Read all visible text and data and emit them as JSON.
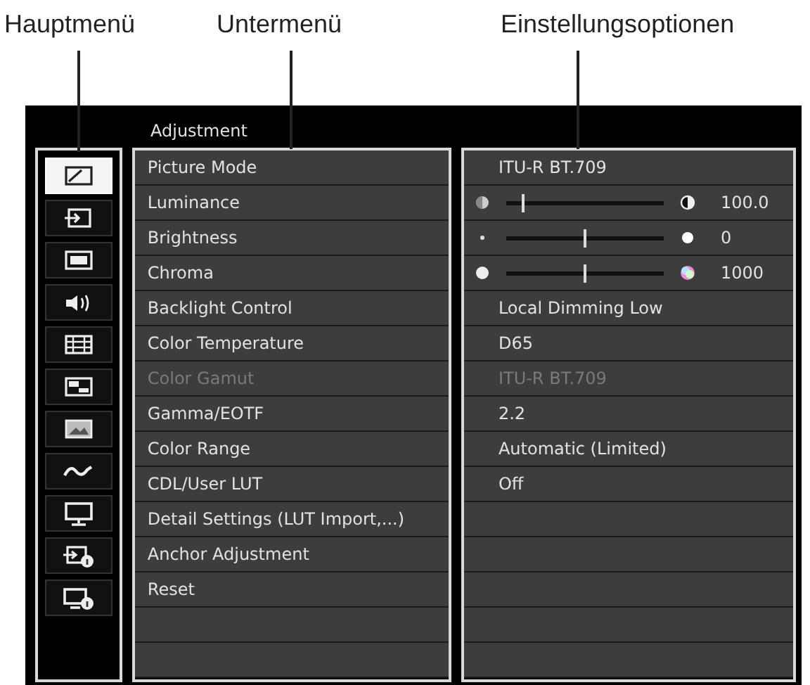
{
  "labels": [
    {
      "text": "Hauptmenü"
    },
    {
      "text": "Untermenü"
    },
    {
      "text": "Einstellungsoptionen"
    }
  ],
  "main_menu": {
    "items": [
      {
        "selected": true
      },
      {
        "selected": false
      },
      {
        "selected": false
      },
      {
        "selected": false
      },
      {
        "selected": false
      },
      {
        "selected": false
      },
      {
        "selected": false
      },
      {
        "selected": false
      },
      {
        "selected": false
      },
      {
        "selected": false
      },
      {
        "selected": false
      }
    ]
  },
  "submenu": {
    "title": "Adjustment",
    "items": [
      {
        "label": "Picture Mode",
        "disabled": false
      },
      {
        "label": "Luminance",
        "disabled": false
      },
      {
        "label": "Brightness",
        "disabled": false
      },
      {
        "label": "Chroma",
        "disabled": false
      },
      {
        "label": "Backlight Control",
        "disabled": false
      },
      {
        "label": "Color Temperature",
        "disabled": false
      },
      {
        "label": "Color Gamut",
        "disabled": true
      },
      {
        "label": "Gamma/EOTF",
        "disabled": false
      },
      {
        "label": "Color Range",
        "disabled": false
      },
      {
        "label": "CDL/User LUT",
        "disabled": false
      },
      {
        "label": "Detail Settings (LUT Import,...)",
        "disabled": false
      },
      {
        "label": "Anchor Adjustment",
        "disabled": false
      },
      {
        "label": "Reset",
        "disabled": false
      }
    ]
  },
  "options": [
    {
      "kind": "text",
      "value": "ITU-R BT.709",
      "disabled": false
    },
    {
      "kind": "slider",
      "level": 0.1,
      "reading": "100.0"
    },
    {
      "kind": "slider",
      "level": 0.5,
      "reading": "0"
    },
    {
      "kind": "slider",
      "level": 0.5,
      "reading": "1000"
    },
    {
      "kind": "text",
      "value": "Local Dimming Low",
      "disabled": false
    },
    {
      "kind": "text",
      "value": "D65",
      "disabled": false
    },
    {
      "kind": "text",
      "value": "ITU-R BT.709",
      "disabled": true
    },
    {
      "kind": "text",
      "value": "2.2",
      "disabled": false
    },
    {
      "kind": "text",
      "value": "Automatic (Limited)",
      "disabled": false
    },
    {
      "kind": "text",
      "value": "Off",
      "disabled": false
    }
  ]
}
